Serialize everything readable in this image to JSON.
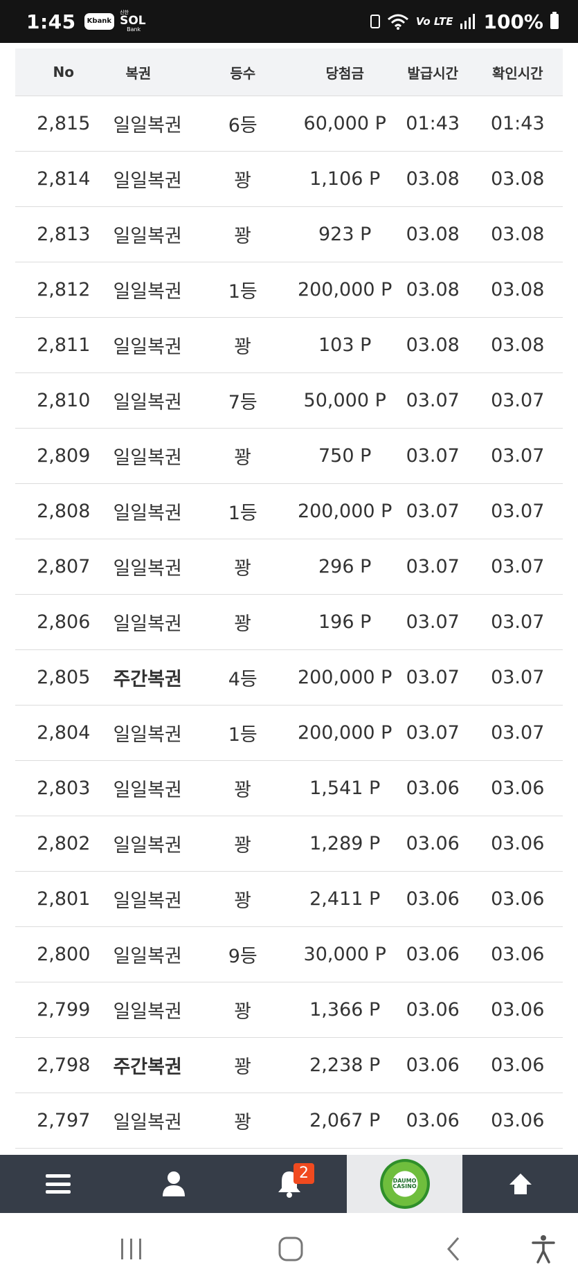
{
  "status_bar": {
    "time": "1:45",
    "kbank": "Kbank",
    "sol_top": "신한",
    "sol_main": "SOL",
    "sol_bottom": "Bank",
    "lte": "Vo LTE",
    "battery": "100%"
  },
  "table": {
    "headers": [
      "No",
      "복권",
      "등수",
      "당첨금",
      "발급시간",
      "확인시간"
    ],
    "rows": [
      {
        "no": "2,815",
        "type": "일일복권",
        "grade": "6등",
        "prize": "60,000 P",
        "issued": "01:43",
        "checked": "01:43",
        "bold": false
      },
      {
        "no": "2,814",
        "type": "일일복권",
        "grade": "꽝",
        "prize": "1,106 P",
        "issued": "03.08",
        "checked": "03.08",
        "bold": false
      },
      {
        "no": "2,813",
        "type": "일일복권",
        "grade": "꽝",
        "prize": "923 P",
        "issued": "03.08",
        "checked": "03.08",
        "bold": false
      },
      {
        "no": "2,812",
        "type": "일일복권",
        "grade": "1등",
        "prize": "200,000 P",
        "issued": "03.08",
        "checked": "03.08",
        "bold": false
      },
      {
        "no": "2,811",
        "type": "일일복권",
        "grade": "꽝",
        "prize": "103 P",
        "issued": "03.08",
        "checked": "03.08",
        "bold": false
      },
      {
        "no": "2,810",
        "type": "일일복권",
        "grade": "7등",
        "prize": "50,000 P",
        "issued": "03.07",
        "checked": "03.07",
        "bold": false
      },
      {
        "no": "2,809",
        "type": "일일복권",
        "grade": "꽝",
        "prize": "750 P",
        "issued": "03.07",
        "checked": "03.07",
        "bold": false
      },
      {
        "no": "2,808",
        "type": "일일복권",
        "grade": "1등",
        "prize": "200,000 P",
        "issued": "03.07",
        "checked": "03.07",
        "bold": false
      },
      {
        "no": "2,807",
        "type": "일일복권",
        "grade": "꽝",
        "prize": "296 P",
        "issued": "03.07",
        "checked": "03.07",
        "bold": false
      },
      {
        "no": "2,806",
        "type": "일일복권",
        "grade": "꽝",
        "prize": "196 P",
        "issued": "03.07",
        "checked": "03.07",
        "bold": false
      },
      {
        "no": "2,805",
        "type": "주간복권",
        "grade": "4등",
        "prize": "200,000 P",
        "issued": "03.07",
        "checked": "03.07",
        "bold": true
      },
      {
        "no": "2,804",
        "type": "일일복권",
        "grade": "1등",
        "prize": "200,000 P",
        "issued": "03.07",
        "checked": "03.07",
        "bold": false
      },
      {
        "no": "2,803",
        "type": "일일복권",
        "grade": "꽝",
        "prize": "1,541 P",
        "issued": "03.06",
        "checked": "03.06",
        "bold": false
      },
      {
        "no": "2,802",
        "type": "일일복권",
        "grade": "꽝",
        "prize": "1,289 P",
        "issued": "03.06",
        "checked": "03.06",
        "bold": false
      },
      {
        "no": "2,801",
        "type": "일일복권",
        "grade": "꽝",
        "prize": "2,411 P",
        "issued": "03.06",
        "checked": "03.06",
        "bold": false
      },
      {
        "no": "2,800",
        "type": "일일복권",
        "grade": "9등",
        "prize": "30,000 P",
        "issued": "03.06",
        "checked": "03.06",
        "bold": false
      },
      {
        "no": "2,799",
        "type": "일일복권",
        "grade": "꽝",
        "prize": "1,366 P",
        "issued": "03.06",
        "checked": "03.06",
        "bold": false
      },
      {
        "no": "2,798",
        "type": "주간복권",
        "grade": "꽝",
        "prize": "2,238 P",
        "issued": "03.06",
        "checked": "03.06",
        "bold": true
      },
      {
        "no": "2,797",
        "type": "일일복권",
        "grade": "꽝",
        "prize": "2,067 P",
        "issued": "03.06",
        "checked": "03.06",
        "bold": false
      }
    ]
  },
  "bottom_nav": {
    "notification_count": "2",
    "casino_line1": "DAUMO",
    "casino_line2": "CASINO"
  },
  "colors": {
    "status_bar_bg": "#141414",
    "header_bg": "#f2f3f5",
    "bottom_nav_bg": "#363d48",
    "badge": "#f04a1f"
  }
}
